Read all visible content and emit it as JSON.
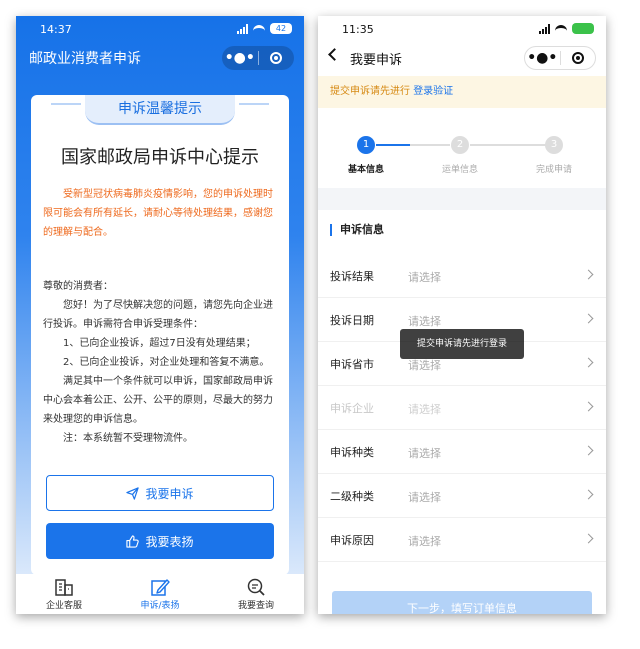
{
  "left": {
    "status": {
      "time": "14:37",
      "battery": "42"
    },
    "app_title": "邮政业消费者申诉",
    "card": {
      "ribbon": "申诉温馨提示",
      "title": "国家邮政局申诉中心提示",
      "notice": "受新型冠状病毒肺炎疫情影响，您的申诉处理时限可能会有所有延长，请耐心等待处理结果，感谢您的理解与配合。",
      "greeting": "尊敬的消费者：",
      "para1": "您好！为了尽快解决您的问题，请您先向企业进行投诉。申诉需符合申诉受理条件：",
      "cond1": "1、已向企业投诉，超过7日没有处理结果；",
      "cond2": "2、已向企业投诉，对企业处理和答复不满意。",
      "para2": "满足其中一个条件就可以申诉，国家邮政局申诉中心会本着公正、公开、公平的原则，尽最大的努力来处理您的申诉信息。",
      "note": "注：本系统暂不受理物流件。",
      "btn_complain": "我要申诉",
      "btn_praise": "我要表扬"
    },
    "tabs": [
      {
        "label": "企业客服"
      },
      {
        "label": "申诉/表扬"
      },
      {
        "label": "我要查询"
      }
    ]
  },
  "right": {
    "status": {
      "time": "11:35"
    },
    "app_title": "我要申诉",
    "tip": {
      "text": "提交申诉请先进行",
      "link": "登录验证"
    },
    "steps": [
      {
        "num": "1",
        "label": "基本信息"
      },
      {
        "num": "2",
        "label": "运单信息"
      },
      {
        "num": "3",
        "label": "完成申请"
      }
    ],
    "section_title": "申诉信息",
    "rows": [
      {
        "label": "投诉结果",
        "placeholder": "请选择"
      },
      {
        "label": "投诉日期",
        "placeholder": "请选择"
      },
      {
        "label": "申诉省市",
        "placeholder": "请选择"
      },
      {
        "label": "申诉企业",
        "placeholder": "请选择"
      },
      {
        "label": "申诉种类",
        "placeholder": "请选择"
      },
      {
        "label": "二级种类",
        "placeholder": "请选择"
      },
      {
        "label": "申诉原因",
        "placeholder": "请选择"
      }
    ],
    "toast": "提交申诉请先进行登录",
    "next_button": "下一步，填写订单信息"
  },
  "colors": {
    "brand_blue": "#1b74ea",
    "notice_orange": "#ee6a1e",
    "tip_bg": "#fdf6e3"
  }
}
